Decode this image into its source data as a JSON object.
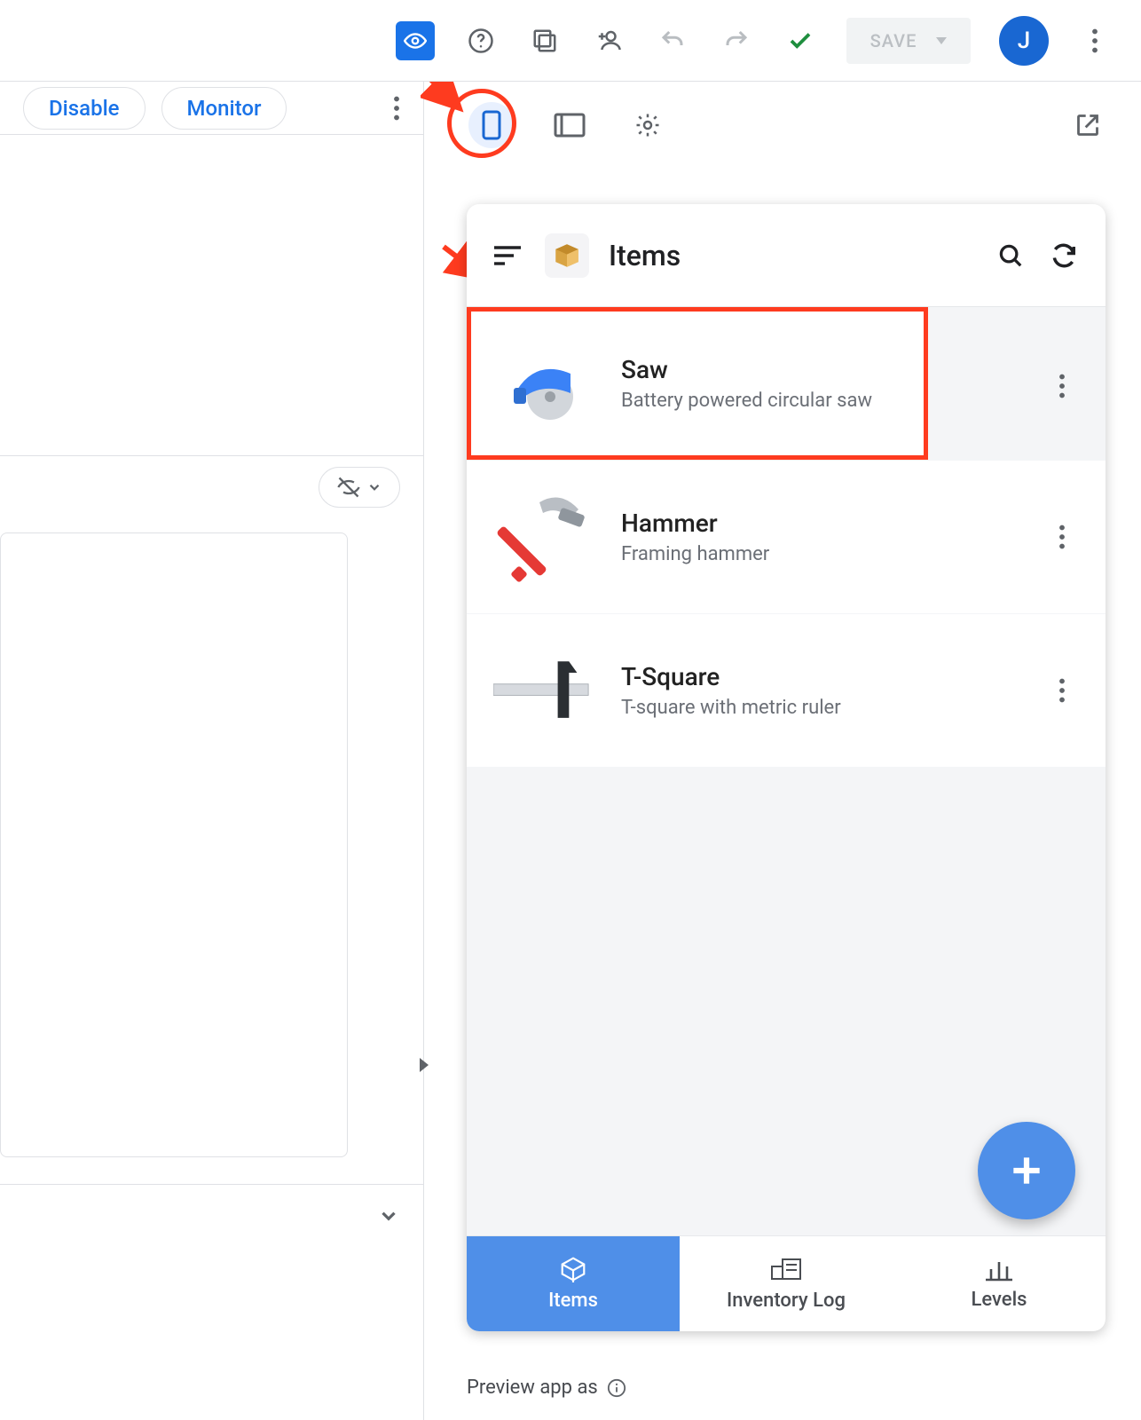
{
  "toolbar": {
    "save_label": "SAVE",
    "avatar_initial": "J"
  },
  "left_pane": {
    "chips": {
      "disable": "Disable",
      "monitor": "Monitor"
    }
  },
  "preview": {
    "header": {
      "title": "Items"
    },
    "items": [
      {
        "title": "Saw",
        "subtitle": "Battery powered circular saw"
      },
      {
        "title": "Hammer",
        "subtitle": "Framing hammer"
      },
      {
        "title": "T-Square",
        "subtitle": "T-square with metric ruler"
      }
    ],
    "tabs": [
      {
        "label": "Items"
      },
      {
        "label": "Inventory Log"
      },
      {
        "label": "Levels"
      }
    ]
  },
  "footer": {
    "text": "Preview app as"
  }
}
